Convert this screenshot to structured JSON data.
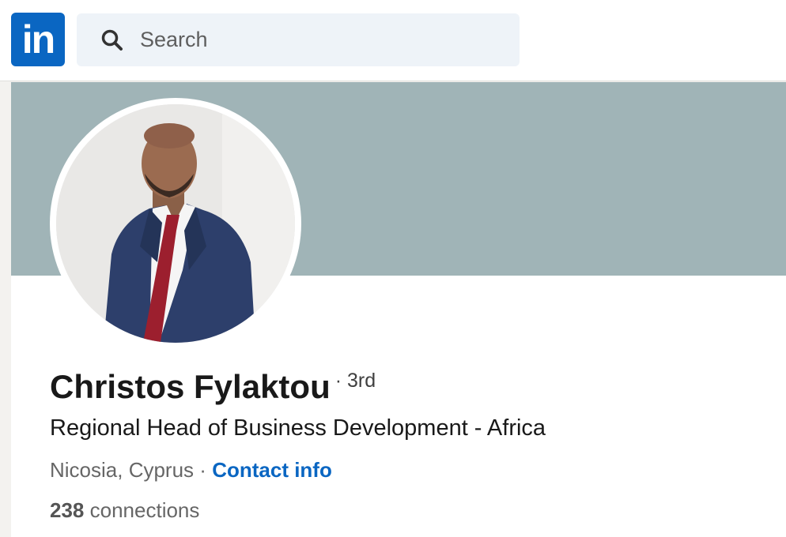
{
  "header": {
    "logo_text": "in",
    "search": {
      "placeholder": "Search",
      "icon": "search-icon"
    }
  },
  "profile": {
    "banner_color": "#a0b4b7",
    "name": "Christos Fylaktou",
    "degree": "· 3rd",
    "headline": "Regional Head of Business Development - Africa",
    "location": "Nicosia, Cyprus",
    "separator": "·",
    "contact_info_label": "Contact info",
    "connections_count": "238",
    "connections_label": "connections"
  },
  "colors": {
    "brand": "#0a66c2",
    "search_bg": "#eef3f8",
    "text_primary": "#191919",
    "text_secondary": "#666666"
  }
}
